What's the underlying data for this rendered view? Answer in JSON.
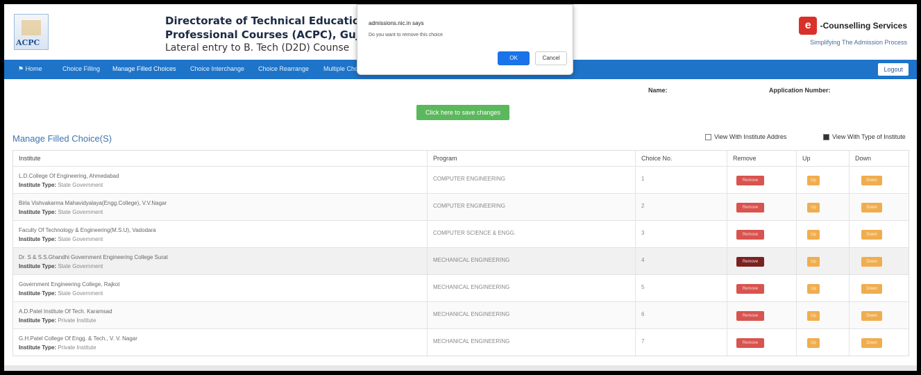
{
  "header": {
    "logo_text": "ACPC",
    "title_line1": "Directorate of Technical Education, A",
    "title_line2": "Professional Courses (ACPC), Gujarat",
    "title_line3": "Lateral entry to B. Tech (D2D) Counse",
    "brand_badge": "e",
    "brand_name": "-Counselling Services",
    "brand_tagline": "Simplifying The Admission Process"
  },
  "nav": {
    "home": "Home",
    "items": [
      "Choice Filling",
      "Manage Filled Choices",
      "Choice Interchange",
      "Choice Rearrange",
      "Multiple Choices"
    ],
    "logout": "Logout"
  },
  "info": {
    "name_label": "Name:",
    "app_label": "Application Number:"
  },
  "save_button": "Click here to save changes",
  "section_title": "Manage Filled Choice(S)",
  "options": {
    "view_address": "View With Institute Addres",
    "view_type": "View With Type of Institute",
    "view_address_checked": false,
    "view_type_checked": true
  },
  "table": {
    "headers": [
      "Institute",
      "Program",
      "Choice No.",
      "Remove",
      "Up",
      "Down"
    ],
    "type_label": "Institute Type:",
    "remove_label": "Remove",
    "up_label": "Up",
    "down_label": "Down",
    "rows": [
      {
        "institute": "L.D.College Of Engineering, Ahmedabad",
        "type": "State Government",
        "program": "COMPUTER ENGINEERING",
        "choice_no": "1"
      },
      {
        "institute": "Birla Vishvakarma Mahavidyalaya(Engg.College), V.V.Nagar",
        "type": "State Government",
        "program": "COMPUTER ENGINEERING",
        "choice_no": "2"
      },
      {
        "institute": "Faculty Of Technology & Engineering(M.S.U), Vadodara",
        "type": "State Government",
        "program": "COMPUTER SCIENCE & ENGG.",
        "choice_no": "3"
      },
      {
        "institute": "Dr. S & S.S.Ghandhi Government Engineering College Surat",
        "type": "State Government",
        "program": "MECHANICAL ENGINEERING",
        "choice_no": "4"
      },
      {
        "institute": "Government Engineering College, Rajkot",
        "type": "State Government",
        "program": "MECHANICAL ENGINEERING",
        "choice_no": "5"
      },
      {
        "institute": "A.D.Patel Institute Of Tech. Karamsad",
        "type": "Private Institute",
        "program": "MECHANICAL ENGINEERING",
        "choice_no": "6"
      },
      {
        "institute": "G.H.Patel College Of Engg. & Tech., V. V. Nagar",
        "type": "Private Institute",
        "program": "MECHANICAL ENGINEERING",
        "choice_no": "7"
      }
    ]
  },
  "dialog": {
    "site": "admissions.nic.in says",
    "message": "Do you want to remove this choice",
    "ok": "OK",
    "cancel": "Cancel"
  }
}
